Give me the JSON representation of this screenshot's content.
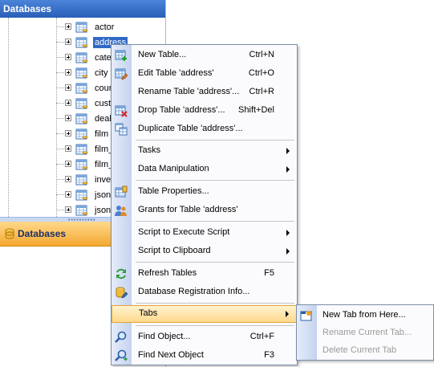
{
  "explorer": {
    "header": "Databases",
    "tables": [
      {
        "label": "actor"
      },
      {
        "label": "address",
        "selected": true
      },
      {
        "label": "cate"
      },
      {
        "label": "city"
      },
      {
        "label": "coun"
      },
      {
        "label": "cust"
      },
      {
        "label": "deals"
      },
      {
        "label": "film"
      },
      {
        "label": "film_"
      },
      {
        "label": "film_"
      },
      {
        "label": "inver"
      },
      {
        "label": "jsonc"
      },
      {
        "label": "jsonc"
      }
    ],
    "splitter_dots": "••••••••••",
    "bottom_tab": "Databases"
  },
  "menu": {
    "new_table": {
      "label": "New Table...",
      "shortcut": "Ctrl+N",
      "icon": "new-table-icon"
    },
    "edit_table": {
      "label": "Edit Table 'address'",
      "shortcut": "Ctrl+O",
      "icon": "edit-table-icon"
    },
    "rename_table": {
      "label": "Rename Table 'address'...",
      "shortcut": "Ctrl+R"
    },
    "drop_table": {
      "label": "Drop Table 'address'...",
      "shortcut": "Shift+Del",
      "icon": "drop-table-icon"
    },
    "duplicate_table": {
      "label": "Duplicate Table 'address'...",
      "icon": "duplicate-table-icon"
    },
    "tasks": {
      "label": "Tasks"
    },
    "data_manipulation": {
      "label": "Data Manipulation"
    },
    "table_properties": {
      "label": "Table Properties...",
      "icon": "table-properties-icon"
    },
    "grants": {
      "label": "Grants for Table 'address'",
      "icon": "grants-icon"
    },
    "script_execute": {
      "label": "Script to Execute Script"
    },
    "script_clipboard": {
      "label": "Script to Clipboard"
    },
    "refresh": {
      "label": "Refresh Tables",
      "shortcut": "F5",
      "icon": "refresh-icon"
    },
    "db_registration": {
      "label": "Database Registration Info...",
      "icon": "database-registration-icon"
    },
    "tabs": {
      "label": "Tabs"
    },
    "find_object": {
      "label": "Find Object...",
      "shortcut": "Ctrl+F",
      "icon": "find-icon"
    },
    "find_next": {
      "label": "Find Next Object",
      "shortcut": "F3",
      "icon": "find-next-icon"
    }
  },
  "submenu": {
    "new_tab": {
      "label": "New Tab from Here...",
      "icon": "new-tab-icon"
    },
    "rename_tab": {
      "label": "Rename Current Tab...",
      "disabled": true
    },
    "delete_tab": {
      "label": "Delete Current Tab",
      "disabled": true
    }
  },
  "colors": {
    "header_blue": "#2a5fb8",
    "selection": "#316ac5",
    "highlight_orange": "#ffd98c",
    "bottom_tab_orange": "#f4a830"
  }
}
